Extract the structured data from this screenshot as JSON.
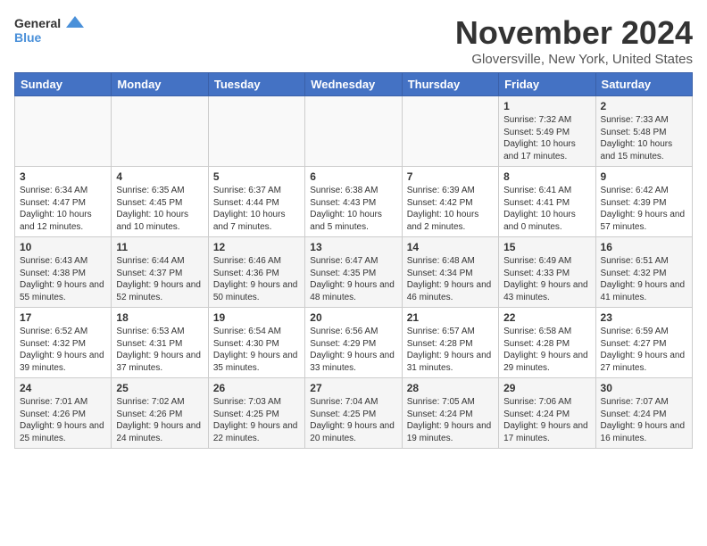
{
  "logo": {
    "line1": "General",
    "line2": "Blue",
    "icon_color": "#4a90d9"
  },
  "title": "November 2024",
  "subtitle": "Gloversville, New York, United States",
  "days_of_week": [
    "Sunday",
    "Monday",
    "Tuesday",
    "Wednesday",
    "Thursday",
    "Friday",
    "Saturday"
  ],
  "weeks": [
    [
      {
        "day": "",
        "info": ""
      },
      {
        "day": "",
        "info": ""
      },
      {
        "day": "",
        "info": ""
      },
      {
        "day": "",
        "info": ""
      },
      {
        "day": "",
        "info": ""
      },
      {
        "day": "1",
        "info": "Sunrise: 7:32 AM\nSunset: 5:49 PM\nDaylight: 10 hours and 17 minutes."
      },
      {
        "day": "2",
        "info": "Sunrise: 7:33 AM\nSunset: 5:48 PM\nDaylight: 10 hours and 15 minutes."
      }
    ],
    [
      {
        "day": "3",
        "info": "Sunrise: 6:34 AM\nSunset: 4:47 PM\nDaylight: 10 hours and 12 minutes."
      },
      {
        "day": "4",
        "info": "Sunrise: 6:35 AM\nSunset: 4:45 PM\nDaylight: 10 hours and 10 minutes."
      },
      {
        "day": "5",
        "info": "Sunrise: 6:37 AM\nSunset: 4:44 PM\nDaylight: 10 hours and 7 minutes."
      },
      {
        "day": "6",
        "info": "Sunrise: 6:38 AM\nSunset: 4:43 PM\nDaylight: 10 hours and 5 minutes."
      },
      {
        "day": "7",
        "info": "Sunrise: 6:39 AM\nSunset: 4:42 PM\nDaylight: 10 hours and 2 minutes."
      },
      {
        "day": "8",
        "info": "Sunrise: 6:41 AM\nSunset: 4:41 PM\nDaylight: 10 hours and 0 minutes."
      },
      {
        "day": "9",
        "info": "Sunrise: 6:42 AM\nSunset: 4:39 PM\nDaylight: 9 hours and 57 minutes."
      }
    ],
    [
      {
        "day": "10",
        "info": "Sunrise: 6:43 AM\nSunset: 4:38 PM\nDaylight: 9 hours and 55 minutes."
      },
      {
        "day": "11",
        "info": "Sunrise: 6:44 AM\nSunset: 4:37 PM\nDaylight: 9 hours and 52 minutes."
      },
      {
        "day": "12",
        "info": "Sunrise: 6:46 AM\nSunset: 4:36 PM\nDaylight: 9 hours and 50 minutes."
      },
      {
        "day": "13",
        "info": "Sunrise: 6:47 AM\nSunset: 4:35 PM\nDaylight: 9 hours and 48 minutes."
      },
      {
        "day": "14",
        "info": "Sunrise: 6:48 AM\nSunset: 4:34 PM\nDaylight: 9 hours and 46 minutes."
      },
      {
        "day": "15",
        "info": "Sunrise: 6:49 AM\nSunset: 4:33 PM\nDaylight: 9 hours and 43 minutes."
      },
      {
        "day": "16",
        "info": "Sunrise: 6:51 AM\nSunset: 4:32 PM\nDaylight: 9 hours and 41 minutes."
      }
    ],
    [
      {
        "day": "17",
        "info": "Sunrise: 6:52 AM\nSunset: 4:32 PM\nDaylight: 9 hours and 39 minutes."
      },
      {
        "day": "18",
        "info": "Sunrise: 6:53 AM\nSunset: 4:31 PM\nDaylight: 9 hours and 37 minutes."
      },
      {
        "day": "19",
        "info": "Sunrise: 6:54 AM\nSunset: 4:30 PM\nDaylight: 9 hours and 35 minutes."
      },
      {
        "day": "20",
        "info": "Sunrise: 6:56 AM\nSunset: 4:29 PM\nDaylight: 9 hours and 33 minutes."
      },
      {
        "day": "21",
        "info": "Sunrise: 6:57 AM\nSunset: 4:28 PM\nDaylight: 9 hours and 31 minutes."
      },
      {
        "day": "22",
        "info": "Sunrise: 6:58 AM\nSunset: 4:28 PM\nDaylight: 9 hours and 29 minutes."
      },
      {
        "day": "23",
        "info": "Sunrise: 6:59 AM\nSunset: 4:27 PM\nDaylight: 9 hours and 27 minutes."
      }
    ],
    [
      {
        "day": "24",
        "info": "Sunrise: 7:01 AM\nSunset: 4:26 PM\nDaylight: 9 hours and 25 minutes."
      },
      {
        "day": "25",
        "info": "Sunrise: 7:02 AM\nSunset: 4:26 PM\nDaylight: 9 hours and 24 minutes."
      },
      {
        "day": "26",
        "info": "Sunrise: 7:03 AM\nSunset: 4:25 PM\nDaylight: 9 hours and 22 minutes."
      },
      {
        "day": "27",
        "info": "Sunrise: 7:04 AM\nSunset: 4:25 PM\nDaylight: 9 hours and 20 minutes."
      },
      {
        "day": "28",
        "info": "Sunrise: 7:05 AM\nSunset: 4:24 PM\nDaylight: 9 hours and 19 minutes."
      },
      {
        "day": "29",
        "info": "Sunrise: 7:06 AM\nSunset: 4:24 PM\nDaylight: 9 hours and 17 minutes."
      },
      {
        "day": "30",
        "info": "Sunrise: 7:07 AM\nSunset: 4:24 PM\nDaylight: 9 hours and 16 minutes."
      }
    ]
  ]
}
